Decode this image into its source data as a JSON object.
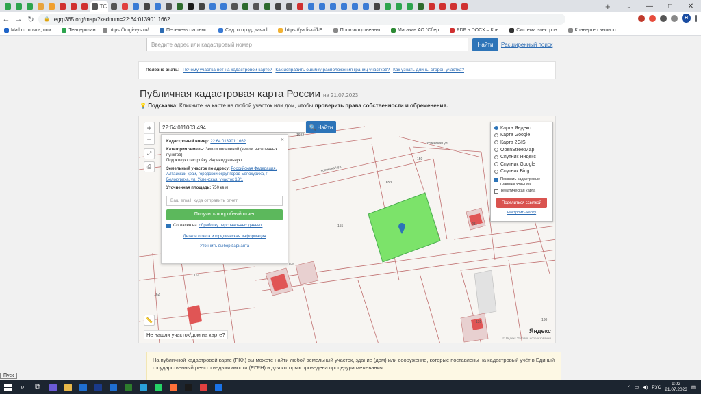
{
  "browser": {
    "tab_colors": [
      "#2da44e",
      "#2da44e",
      "#2da44e",
      "#e8a33d",
      "#f0a030",
      "#d03030",
      "#d03030",
      "#d03030",
      "#555",
      "#555",
      "#e04040",
      "#3a7bd5",
      "#444",
      "#3a7bd5",
      "#555",
      "#2d6a2d",
      "#1a1a1a",
      "#444",
      "#3a7bd5",
      "#3a7bd5",
      "#555",
      "#2d6a2d",
      "#555",
      "#2d6a2d",
      "#444",
      "#555",
      "#d03030",
      "#3a7bd5",
      "#3a7bd5",
      "#3a7bd5",
      "#3a7bd5",
      "#3a7bd5",
      "#3a7bd5",
      "#444",
      "#2da44e",
      "#2da44e",
      "#2da44e",
      "#2d6a2d",
      "#d03030",
      "#d03030",
      "#d03030",
      "#d03030"
    ],
    "active_tab_label": "TC",
    "new_tab_label": "+",
    "url": "egrp365.org/map/?kadnum=22:64:013901:1662",
    "window_controls": [
      "⌄",
      "—",
      "□",
      "✕"
    ],
    "profile_initial": "H",
    "bookmarks": [
      {
        "label": "Mail.ru: почта, пои...",
        "color": "#1f64c8"
      },
      {
        "label": "Тендерплан",
        "color": "#2da44e"
      },
      {
        "label": "https://torgi-vys.ru/...",
        "color": "#888"
      },
      {
        "label": "Перечень системо...",
        "color": "#2d6cb3"
      },
      {
        "label": "Сад, огород, дача l...",
        "color": "#3a7bd5"
      },
      {
        "label": "https://yadisk/i/kE...",
        "color": "#f2b233"
      },
      {
        "label": "Производственны...",
        "color": "#888"
      },
      {
        "label": "Магазин АО \"Сбер...",
        "color": "#2d8a34"
      },
      {
        "label": "PDF в DOCX – Кон...",
        "color": "#d03030"
      },
      {
        "label": "Система электрон...",
        "color": "#333"
      },
      {
        "label": "Конвертер выписо...",
        "color": "#888"
      }
    ]
  },
  "search": {
    "placeholder": "Введите адрес или кадастровый номер",
    "button": "Найти",
    "advanced": "Расширенный поиск"
  },
  "useful": {
    "label": "Полезно знать:",
    "links": [
      "Почему участка нет на кадастровой карте?",
      "Как исправить ошибку расположения границ участков?",
      "Как узнать длины сторон участка?"
    ]
  },
  "heading": {
    "title": "Публичная кадастровая карта России",
    "date": "на 21.07.2023"
  },
  "hint": {
    "label": "Подсказка:",
    "text": "Кликните на карте на любой участок или дом, чтобы",
    "bold": "проверить права собственности и обременения."
  },
  "map": {
    "zoom_in": "+",
    "zoom_out": "−",
    "cad_input": "22:64:011003:494",
    "cad_button": "Найти",
    "not_found": "Не нашли участок/дом на карте?",
    "yandex": "Яндекс",
    "copyright": "© Яндекс  Условия использования",
    "labels": [
      "Успенская ул.",
      "Успенская ул.",
      "1653",
      "155",
      "150",
      "1026",
      "161",
      "162",
      "151",
      "211",
      "1692",
      "131",
      "130"
    ]
  },
  "popup": {
    "cadnum_label": "Кадастровый номер:",
    "cadnum_value": "22:64:013901:1662",
    "category_label": "Категория земель:",
    "category_value": "Земли поселений (земли населенных пунктов)",
    "usage": "Под жилую застройку Индивидуальную",
    "address_label": "Земельный участок по адресу:",
    "address_value": "Российская Федерация, Алтайский край, городской округ город Белокуриха, г Белокуриха, ул. Успенская, участок 13/1",
    "area_label": "Уточненная площадь:",
    "area_value": "750 кв.м",
    "email_placeholder": "Ваш email, куда отправить отчет",
    "report_button": "Получить подробный отчет",
    "agree_text": "Согласен на",
    "agree_link": "обработку персональных данных",
    "details_link": "Детали отчета и юридическая информация",
    "sample_link": "Уточнить выбор варианта"
  },
  "layers": {
    "options": [
      {
        "label": "Карта Яндекс",
        "selected": true
      },
      {
        "label": "Карта Google",
        "selected": false
      },
      {
        "label": "Карта 2GIS",
        "selected": false
      },
      {
        "label": "OpenStreetMap",
        "selected": false
      },
      {
        "label": "Спутник Яндекс",
        "selected": false
      },
      {
        "label": "Спутник Google",
        "selected": false
      },
      {
        "label": "Спутник Bing",
        "selected": false
      }
    ],
    "show_borders": "Показать кадастровые границы участков",
    "thematic": "Тематическая карта",
    "share": "Поделиться ссылкой",
    "configure": "Настроить карту"
  },
  "info": {
    "text": "На публичной кадастровой карте (ПКК) вы можете найти любой земельный участок, здание (дом) или сооружение, которые поставлены на кадастровый учёт в Единый государственный реестр недвижимости (ЕГРН) и для которых проведена процедура межевания."
  },
  "taskbar": {
    "start_tip": "Пуск",
    "lang": "РУС",
    "time": "9:02",
    "date": "21.07.2023",
    "app_colors": [
      "#6b5bd6",
      "#e8b84a",
      "#1f6fd0",
      "#1a3a8a",
      "#1f6fd0",
      "#2d7d2d",
      "#2aa1da",
      "#25d366",
      "#ff7139",
      "#1a1a1a",
      "#e04040",
      "#1a73e8"
    ]
  }
}
